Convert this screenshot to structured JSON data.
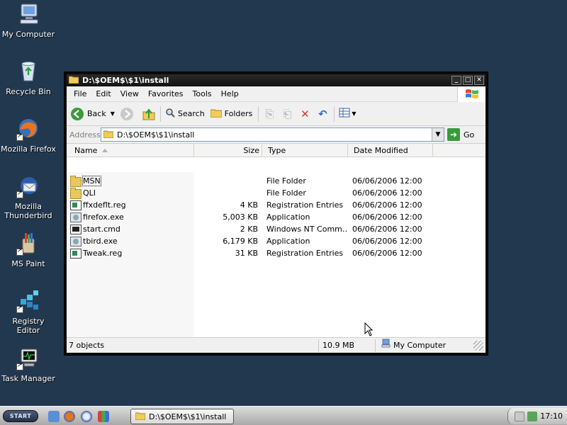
{
  "desktop": {
    "icons": [
      {
        "label": "My Computer",
        "icon": "my-computer-icon"
      },
      {
        "label": "Recycle Bin",
        "icon": "recycle-bin-icon"
      },
      {
        "label": "Mozilla Firefox",
        "icon": "firefox-icon"
      },
      {
        "label": "Mozilla Thunderbird",
        "icon": "thunderbird-icon"
      },
      {
        "label": "MS Paint",
        "icon": "paint-icon"
      },
      {
        "label": "Registry Editor",
        "icon": "registry-editor-icon"
      },
      {
        "label": "Task Manager",
        "icon": "task-manager-icon"
      }
    ]
  },
  "window": {
    "title": "D:\\$OEM$\\$1\\install",
    "menu": [
      "File",
      "Edit",
      "View",
      "Favorites",
      "Tools",
      "Help"
    ],
    "toolbar": {
      "back": "Back",
      "search": "Search",
      "folders": "Folders"
    },
    "address": {
      "label": "Address",
      "value": "D:\\$OEM$\\$1\\install",
      "go": "Go"
    },
    "columns": {
      "name": "Name",
      "size": "Size",
      "type": "Type",
      "date": "Date Modified"
    },
    "files": [
      {
        "name": "MSN",
        "size": "",
        "type": "File Folder",
        "date": "06/06/2006 12:00",
        "icon": "folder-icon"
      },
      {
        "name": "QLI",
        "size": "",
        "type": "File Folder",
        "date": "06/06/2006 12:00",
        "icon": "folder-icon"
      },
      {
        "name": "ffxdeflt.reg",
        "size": "4 KB",
        "type": "Registration Entries",
        "date": "06/06/2006 12:00",
        "icon": "registry-file-icon"
      },
      {
        "name": "firefox.exe",
        "size": "5,003 KB",
        "type": "Application",
        "date": "06/06/2006 12:00",
        "icon": "application-icon"
      },
      {
        "name": "start.cmd",
        "size": "2 KB",
        "type": "Windows NT Comm…",
        "date": "06/06/2006 12:00",
        "icon": "command-script-icon"
      },
      {
        "name": "tbird.exe",
        "size": "6,179 KB",
        "type": "Application",
        "date": "06/06/2006 12:00",
        "icon": "application-icon"
      },
      {
        "name": "Tweak.reg",
        "size": "31 KB",
        "type": "Registration Entries",
        "date": "06/06/2006 12:00",
        "icon": "registry-file-icon"
      }
    ],
    "status": {
      "objects": "7 objects",
      "size": "10.9 MB",
      "location": "My Computer"
    }
  },
  "taskbar": {
    "start": "START",
    "task": "D:\\$OEM$\\$1\\install",
    "clock": "17:10"
  },
  "colors": {
    "desktop": "#22384f",
    "titlebar": "#121212",
    "window_bg": "#ffffff"
  }
}
